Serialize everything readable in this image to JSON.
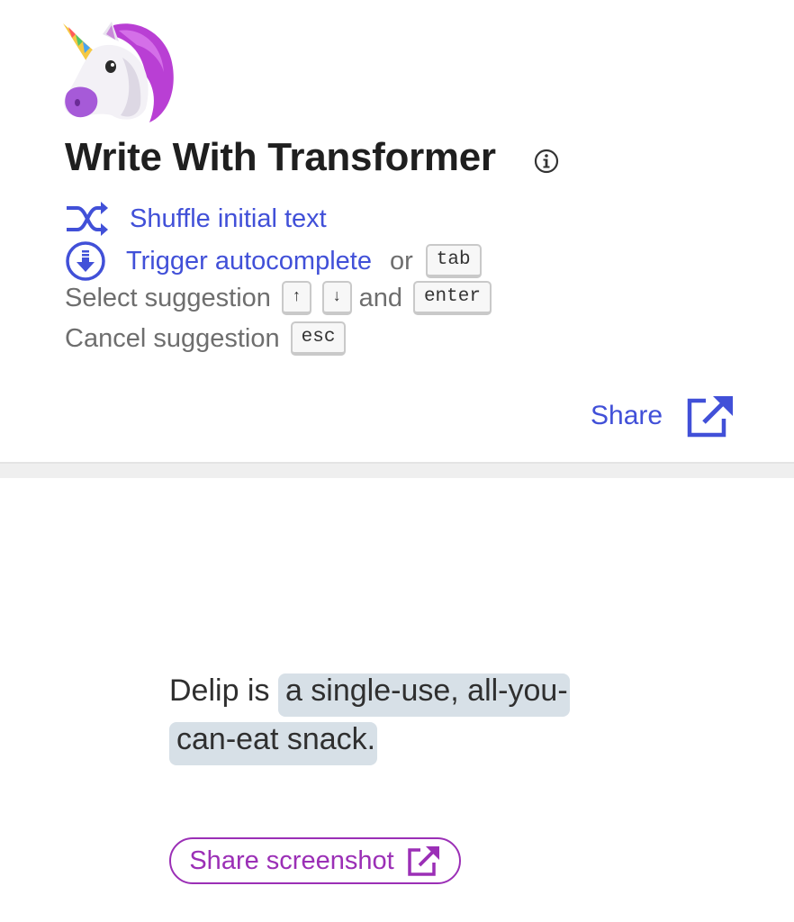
{
  "header": {
    "logo": "unicorn-emoji",
    "title": "Write With Transformer",
    "info_icon": "info-circle-icon"
  },
  "controls": {
    "shuffle": {
      "icon": "shuffle-icon",
      "label": "Shuffle initial text"
    },
    "trigger": {
      "icon": "download-circle-icon",
      "label": "Trigger autocomplete",
      "or_text": "or",
      "key": "tab"
    },
    "select": {
      "label": "Select suggestion",
      "key_up": "↑",
      "key_down": "↓",
      "and_text": "and",
      "key_enter": "enter"
    },
    "cancel": {
      "label": "Cancel suggestion",
      "key": "esc"
    }
  },
  "share": {
    "label": "Share",
    "icon": "external-link-icon"
  },
  "editor": {
    "prompt": "Delip is ",
    "suggestion": "a single-use, all-you-can-eat snack."
  },
  "share_screenshot": {
    "label": "Share screenshot",
    "icon": "external-link-icon"
  },
  "colors": {
    "link": "#4150d8",
    "accent": "#9b2fb6",
    "highlight": "#d7e0e7",
    "divider": "#efefef"
  }
}
